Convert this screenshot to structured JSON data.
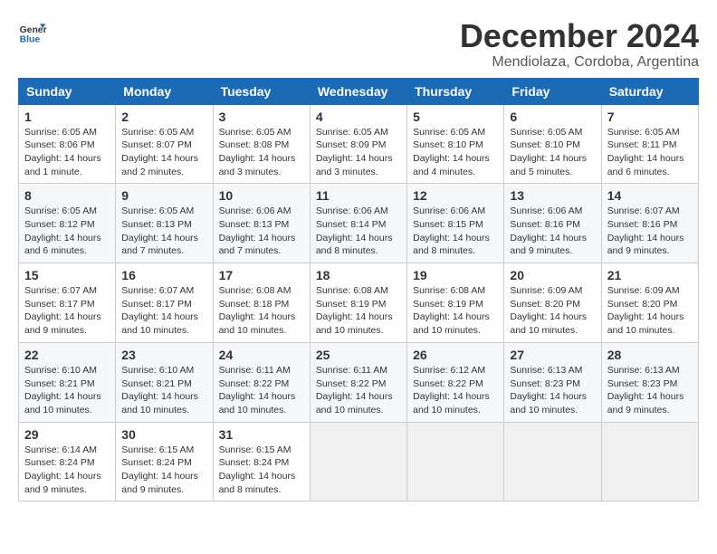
{
  "logo": {
    "line1": "General",
    "line2": "Blue"
  },
  "title": "December 2024",
  "location": "Mendiolaza, Cordoba, Argentina",
  "weekdays": [
    "Sunday",
    "Monday",
    "Tuesday",
    "Wednesday",
    "Thursday",
    "Friday",
    "Saturday"
  ],
  "weeks": [
    [
      {
        "day": "1",
        "sunrise": "Sunrise: 6:05 AM",
        "sunset": "Sunset: 8:06 PM",
        "daylight": "Daylight: 14 hours and 1 minute."
      },
      {
        "day": "2",
        "sunrise": "Sunrise: 6:05 AM",
        "sunset": "Sunset: 8:07 PM",
        "daylight": "Daylight: 14 hours and 2 minutes."
      },
      {
        "day": "3",
        "sunrise": "Sunrise: 6:05 AM",
        "sunset": "Sunset: 8:08 PM",
        "daylight": "Daylight: 14 hours and 3 minutes."
      },
      {
        "day": "4",
        "sunrise": "Sunrise: 6:05 AM",
        "sunset": "Sunset: 8:09 PM",
        "daylight": "Daylight: 14 hours and 3 minutes."
      },
      {
        "day": "5",
        "sunrise": "Sunrise: 6:05 AM",
        "sunset": "Sunset: 8:10 PM",
        "daylight": "Daylight: 14 hours and 4 minutes."
      },
      {
        "day": "6",
        "sunrise": "Sunrise: 6:05 AM",
        "sunset": "Sunset: 8:10 PM",
        "daylight": "Daylight: 14 hours and 5 minutes."
      },
      {
        "day": "7",
        "sunrise": "Sunrise: 6:05 AM",
        "sunset": "Sunset: 8:11 PM",
        "daylight": "Daylight: 14 hours and 6 minutes."
      }
    ],
    [
      {
        "day": "8",
        "sunrise": "Sunrise: 6:05 AM",
        "sunset": "Sunset: 8:12 PM",
        "daylight": "Daylight: 14 hours and 6 minutes."
      },
      {
        "day": "9",
        "sunrise": "Sunrise: 6:05 AM",
        "sunset": "Sunset: 8:13 PM",
        "daylight": "Daylight: 14 hours and 7 minutes."
      },
      {
        "day": "10",
        "sunrise": "Sunrise: 6:06 AM",
        "sunset": "Sunset: 8:13 PM",
        "daylight": "Daylight: 14 hours and 7 minutes."
      },
      {
        "day": "11",
        "sunrise": "Sunrise: 6:06 AM",
        "sunset": "Sunset: 8:14 PM",
        "daylight": "Daylight: 14 hours and 8 minutes."
      },
      {
        "day": "12",
        "sunrise": "Sunrise: 6:06 AM",
        "sunset": "Sunset: 8:15 PM",
        "daylight": "Daylight: 14 hours and 8 minutes."
      },
      {
        "day": "13",
        "sunrise": "Sunrise: 6:06 AM",
        "sunset": "Sunset: 8:16 PM",
        "daylight": "Daylight: 14 hours and 9 minutes."
      },
      {
        "day": "14",
        "sunrise": "Sunrise: 6:07 AM",
        "sunset": "Sunset: 8:16 PM",
        "daylight": "Daylight: 14 hours and 9 minutes."
      }
    ],
    [
      {
        "day": "15",
        "sunrise": "Sunrise: 6:07 AM",
        "sunset": "Sunset: 8:17 PM",
        "daylight": "Daylight: 14 hours and 9 minutes."
      },
      {
        "day": "16",
        "sunrise": "Sunrise: 6:07 AM",
        "sunset": "Sunset: 8:17 PM",
        "daylight": "Daylight: 14 hours and 10 minutes."
      },
      {
        "day": "17",
        "sunrise": "Sunrise: 6:08 AM",
        "sunset": "Sunset: 8:18 PM",
        "daylight": "Daylight: 14 hours and 10 minutes."
      },
      {
        "day": "18",
        "sunrise": "Sunrise: 6:08 AM",
        "sunset": "Sunset: 8:19 PM",
        "daylight": "Daylight: 14 hours and 10 minutes."
      },
      {
        "day": "19",
        "sunrise": "Sunrise: 6:08 AM",
        "sunset": "Sunset: 8:19 PM",
        "daylight": "Daylight: 14 hours and 10 minutes."
      },
      {
        "day": "20",
        "sunrise": "Sunrise: 6:09 AM",
        "sunset": "Sunset: 8:20 PM",
        "daylight": "Daylight: 14 hours and 10 minutes."
      },
      {
        "day": "21",
        "sunrise": "Sunrise: 6:09 AM",
        "sunset": "Sunset: 8:20 PM",
        "daylight": "Daylight: 14 hours and 10 minutes."
      }
    ],
    [
      {
        "day": "22",
        "sunrise": "Sunrise: 6:10 AM",
        "sunset": "Sunset: 8:21 PM",
        "daylight": "Daylight: 14 hours and 10 minutes."
      },
      {
        "day": "23",
        "sunrise": "Sunrise: 6:10 AM",
        "sunset": "Sunset: 8:21 PM",
        "daylight": "Daylight: 14 hours and 10 minutes."
      },
      {
        "day": "24",
        "sunrise": "Sunrise: 6:11 AM",
        "sunset": "Sunset: 8:22 PM",
        "daylight": "Daylight: 14 hours and 10 minutes."
      },
      {
        "day": "25",
        "sunrise": "Sunrise: 6:11 AM",
        "sunset": "Sunset: 8:22 PM",
        "daylight": "Daylight: 14 hours and 10 minutes."
      },
      {
        "day": "26",
        "sunrise": "Sunrise: 6:12 AM",
        "sunset": "Sunset: 8:22 PM",
        "daylight": "Daylight: 14 hours and 10 minutes."
      },
      {
        "day": "27",
        "sunrise": "Sunrise: 6:13 AM",
        "sunset": "Sunset: 8:23 PM",
        "daylight": "Daylight: 14 hours and 10 minutes."
      },
      {
        "day": "28",
        "sunrise": "Sunrise: 6:13 AM",
        "sunset": "Sunset: 8:23 PM",
        "daylight": "Daylight: 14 hours and 9 minutes."
      }
    ],
    [
      {
        "day": "29",
        "sunrise": "Sunrise: 6:14 AM",
        "sunset": "Sunset: 8:24 PM",
        "daylight": "Daylight: 14 hours and 9 minutes."
      },
      {
        "day": "30",
        "sunrise": "Sunrise: 6:15 AM",
        "sunset": "Sunset: 8:24 PM",
        "daylight": "Daylight: 14 hours and 9 minutes."
      },
      {
        "day": "31",
        "sunrise": "Sunrise: 6:15 AM",
        "sunset": "Sunset: 8:24 PM",
        "daylight": "Daylight: 14 hours and 8 minutes."
      },
      null,
      null,
      null,
      null
    ]
  ]
}
